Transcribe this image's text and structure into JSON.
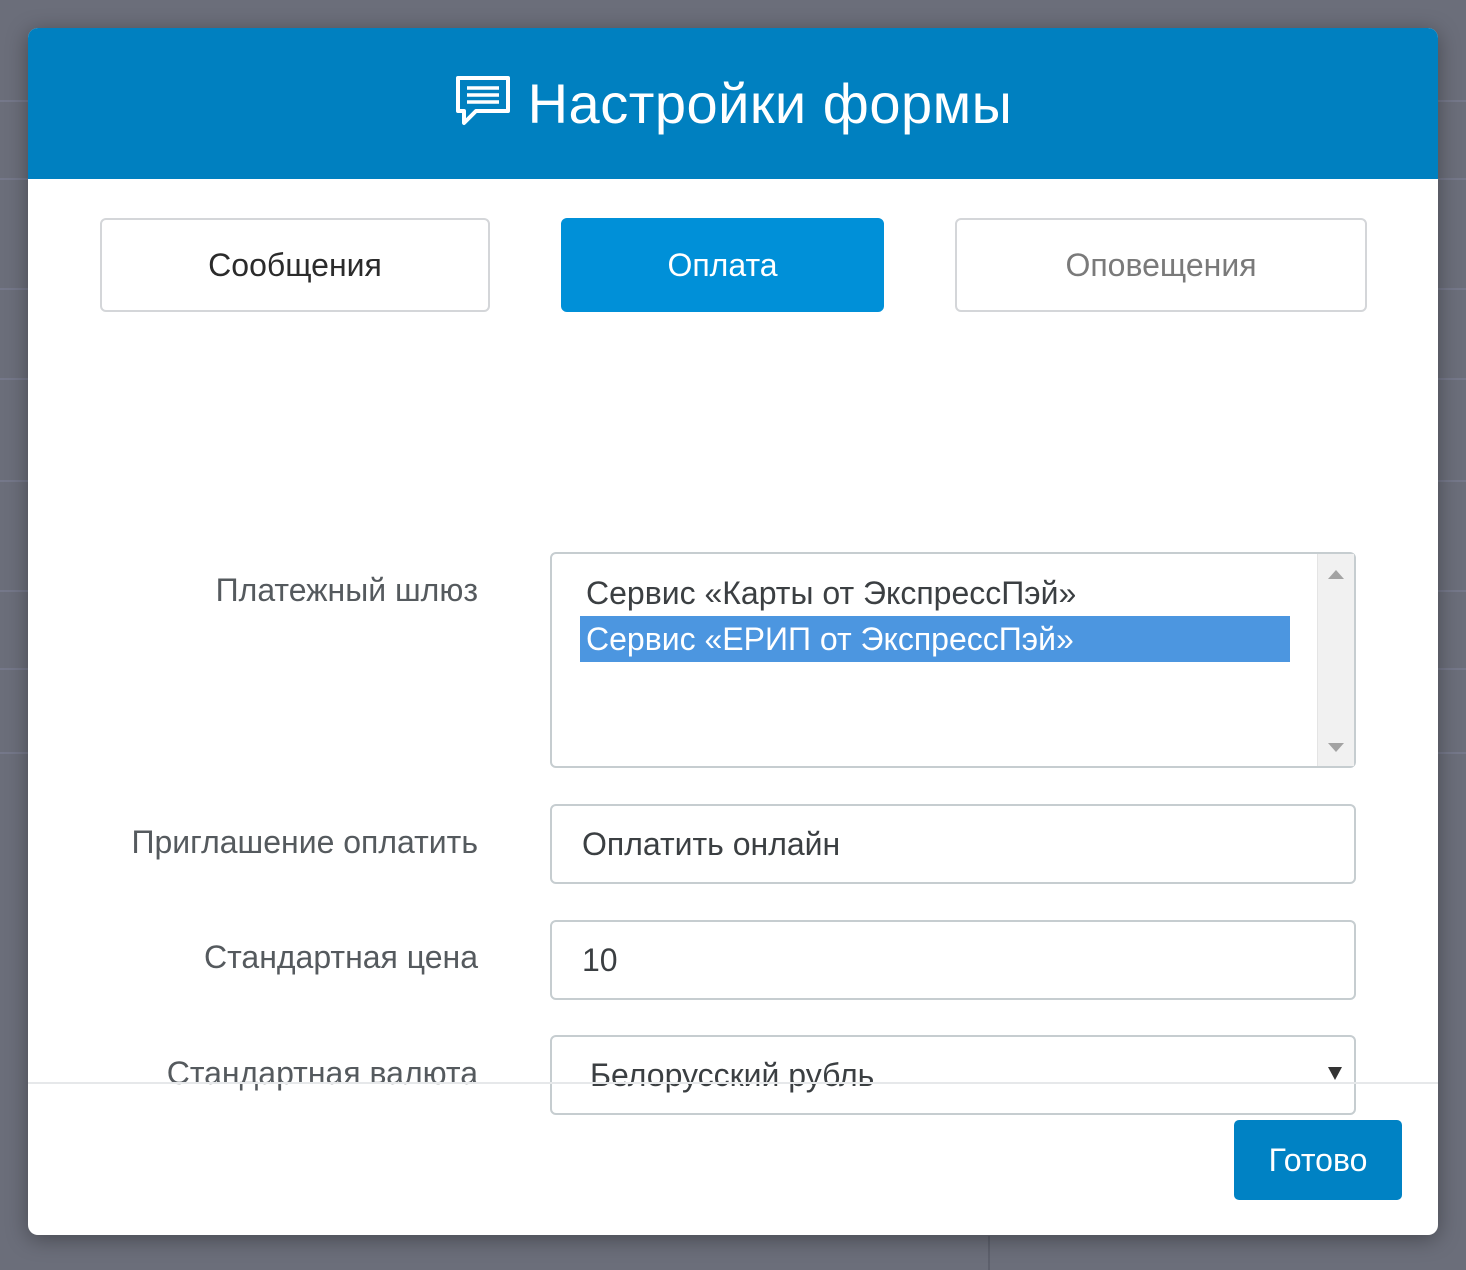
{
  "modal": {
    "title": "Настройки формы",
    "icon": "chat-bubble-icon"
  },
  "tabs": [
    {
      "label": "Сообщения",
      "active": false
    },
    {
      "label": "Оплата",
      "active": true
    },
    {
      "label": "Оповещения",
      "active": false
    }
  ],
  "form": {
    "gateway": {
      "label": "Платежный шлюз",
      "options": [
        {
          "label": "Сервис «Карты от ЭкспрессПэй»",
          "selected": false
        },
        {
          "label": "Сервис «ЕРИП от ЭкспрессПэй»",
          "selected": true
        }
      ]
    },
    "invite": {
      "label": "Приглашение оплатить",
      "value": "Оплатить онлайн"
    },
    "price": {
      "label": "Стандартная цена",
      "value": "10"
    },
    "currency": {
      "label": "Стандартная валюта",
      "value": "Белорусский рубль"
    }
  },
  "footer": {
    "done_label": "Готово"
  },
  "colors": {
    "header": "#0080c0",
    "active_tab": "#0090d8",
    "selected_option": "#4c96e0",
    "done_button": "#0082c4",
    "overlay": "#6b6e7a"
  }
}
